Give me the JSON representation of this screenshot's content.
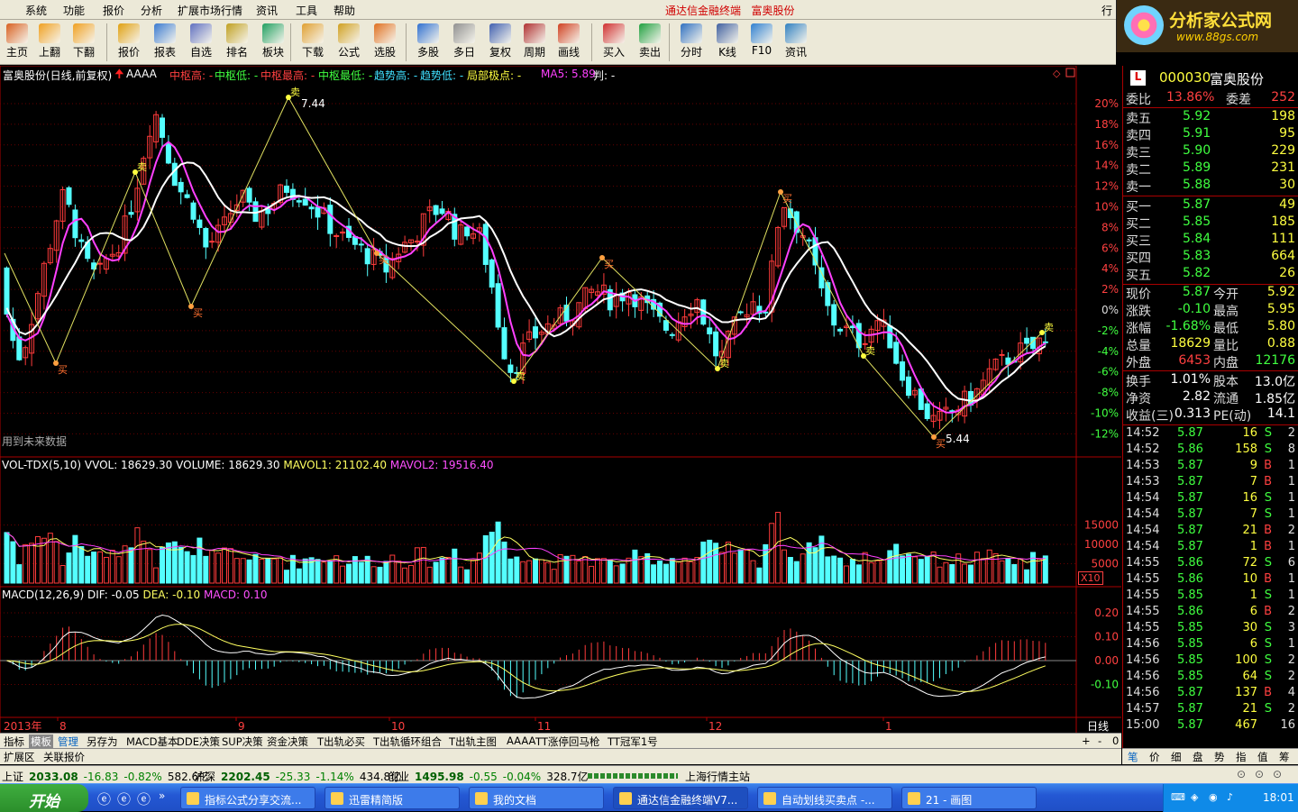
{
  "menu": {
    "items": [
      "系统",
      "功能",
      "报价",
      "分析",
      "扩展市场行情",
      "资讯",
      "工具",
      "帮助"
    ],
    "app_title": "通达信金融终端",
    "stock_name": "富奥股份",
    "right_partial": "行"
  },
  "logo": {
    "text": "分析家公式网",
    "url": "www.88gs.com"
  },
  "toolbar": {
    "buttons": [
      {
        "label": "主页",
        "icon": "home-icon",
        "color": "#d86020"
      },
      {
        "label": "上翻",
        "icon": "arrow-up-icon",
        "color": "#f0a020"
      },
      {
        "label": "下翻",
        "icon": "arrow-down-icon",
        "color": "#f0a020"
      },
      {
        "label": "报价",
        "icon": "yuan-icon",
        "color": "#e0a010"
      },
      {
        "label": "报表",
        "icon": "report-icon",
        "color": "#3a7ad0"
      },
      {
        "label": "自选",
        "icon": "f6-icon",
        "color": "#6070c0"
      },
      {
        "label": "排名",
        "icon": "rank-icon",
        "color": "#c0a020"
      },
      {
        "label": "板块",
        "icon": "sector-icon",
        "color": "#20a060"
      },
      {
        "label": "下载",
        "icon": "download-icon",
        "color": "#e0a030"
      },
      {
        "label": "公式",
        "icon": "formula-icon",
        "color": "#d0a020"
      },
      {
        "label": "选股",
        "icon": "stock-pick-icon",
        "color": "#e07020"
      },
      {
        "label": "多股",
        "icon": "multi-stock-icon",
        "color": "#3070d0"
      },
      {
        "label": "多日",
        "icon": "multi-day-icon",
        "color": "#909090"
      },
      {
        "label": "复权",
        "icon": "adjust-icon",
        "color": "#4060b0"
      },
      {
        "label": "周期",
        "icon": "f8-icon",
        "color": "#b03030"
      },
      {
        "label": "画线",
        "icon": "draw-line-icon",
        "color": "#d04020"
      },
      {
        "label": "买入",
        "icon": "buy-icon",
        "color": "#d03030"
      },
      {
        "label": "卖出",
        "icon": "sell-icon",
        "color": "#20a040"
      },
      {
        "label": "分时",
        "icon": "intraday-icon",
        "color": "#3070c0"
      },
      {
        "label": "K线",
        "icon": "kline-icon",
        "color": "#4060a0"
      },
      {
        "label": "F10",
        "icon": "f10-icon",
        "color": "#3080d0"
      },
      {
        "label": "资讯",
        "icon": "news-icon",
        "color": "#3080c0"
      }
    ]
  },
  "main_header": {
    "title": "富奥股份(日线,前复权)",
    "indicator": "AAAA",
    "items": [
      {
        "text": "中枢高: -",
        "color": "#ff4040"
      },
      {
        "text": "中枢低: -",
        "color": "#40ff40"
      },
      {
        "text": "中枢最高: -",
        "color": "#ff4040"
      },
      {
        "text": "中枢最低: -",
        "color": "#40ff40"
      },
      {
        "text": "趋势高: -",
        "color": "#40e0ff"
      },
      {
        "text": "趋势低: -",
        "color": "#40e0ff"
      },
      {
        "text": "局部极点: -",
        "color": "#ffff40"
      },
      {
        "text": "MA5: 5.89",
        "color": "#ff40ff"
      },
      {
        "text": "判: -",
        "color": "#ffffff"
      }
    ],
    "peak_high": "7.44",
    "trough_low": "5.44",
    "future_note": "用到未来数据",
    "sell_label": "卖",
    "buy_label": "买"
  },
  "vol_header": {
    "name": "VOL-TDX(5,10)",
    "vvol": "VVOL: 18629.30",
    "volume": "VOLUME: 18629.30",
    "mavol1": "MAVOL1: 21102.40",
    "mavol2": "MAVOL2: 19516.40",
    "unit": "X10"
  },
  "macd_header": {
    "name": "MACD(12,26,9)",
    "dif": "DIF: -0.05",
    "dea": "DEA: -0.10",
    "macd": "MACD: 0.10"
  },
  "axes": {
    "price_pct": [
      "20%",
      "18%",
      "16%",
      "14%",
      "12%",
      "10%",
      "8%",
      "6%",
      "4%",
      "2%",
      "0%",
      "-2%",
      "-4%",
      "-6%",
      "-8%",
      "-10%",
      "-12%"
    ],
    "vol": [
      "15000",
      "10000",
      "5000"
    ],
    "macd": [
      "0.20",
      "0.10",
      "0.00",
      "-0.10"
    ],
    "dates": [
      {
        "t": "2013年",
        "c": "#ff4040"
      },
      {
        "t": "8",
        "c": "#ff4040"
      },
      {
        "t": "9",
        "c": "#ff4040"
      },
      {
        "t": "10",
        "c": "#ff4040"
      },
      {
        "t": "11",
        "c": "#ff4040"
      },
      {
        "t": "12",
        "c": "#ff4040"
      },
      {
        "t": "1",
        "c": "#ff4040"
      }
    ],
    "period": "日线"
  },
  "tabs": {
    "row1": [
      "指标",
      "模板",
      "管理",
      "另存为",
      "MACD基本",
      "DDE决策",
      "SUP决策",
      "资金决策",
      "T出轨必买",
      "T出轨循环组合",
      "T出轨主图",
      "AAAA",
      "TT涨停回马枪",
      "TT冠军1号"
    ],
    "row1_ctrl": [
      "+",
      "-",
      "0"
    ],
    "row2": [
      "扩展区",
      "关联报价"
    ]
  },
  "quote": {
    "code": "000030",
    "name": "富奥股份",
    "badge": "L",
    "weibi": {
      "label": "委比",
      "val": "13.86%",
      "label2": "委差",
      "val2": "252"
    },
    "asks": [
      {
        "l": "卖五",
        "p": "5.92",
        "v": "198"
      },
      {
        "l": "卖四",
        "p": "5.91",
        "v": "95"
      },
      {
        "l": "卖三",
        "p": "5.90",
        "v": "229"
      },
      {
        "l": "卖二",
        "p": "5.89",
        "v": "231"
      },
      {
        "l": "卖一",
        "p": "5.88",
        "v": "30"
      }
    ],
    "bids": [
      {
        "l": "买一",
        "p": "5.87",
        "v": "49"
      },
      {
        "l": "买二",
        "p": "5.85",
        "v": "185"
      },
      {
        "l": "买三",
        "p": "5.84",
        "v": "111"
      },
      {
        "l": "买四",
        "p": "5.83",
        "v": "664"
      },
      {
        "l": "买五",
        "p": "5.82",
        "v": "26"
      }
    ],
    "stats": [
      {
        "l1": "现价",
        "v1": "5.87",
        "c1": "#40ff40",
        "l2": "今开",
        "v2": "5.92",
        "c2": "#ffff40"
      },
      {
        "l1": "涨跌",
        "v1": "-0.10",
        "c1": "#40ff40",
        "l2": "最高",
        "v2": "5.95",
        "c2": "#ffff40"
      },
      {
        "l1": "涨幅",
        "v1": "-1.68%",
        "c1": "#40ff40",
        "l2": "最低",
        "v2": "5.80",
        "c2": "#ffff40"
      },
      {
        "l1": "总量",
        "v1": "18629",
        "c1": "#ffff40",
        "l2": "量比",
        "v2": "0.88",
        "c2": "#ffff40"
      },
      {
        "l1": "外盘",
        "v1": "6453",
        "c1": "#ff4040",
        "l2": "内盘",
        "v2": "12176",
        "c2": "#40ff40"
      },
      {
        "l1": "换手",
        "v1": "1.01%",
        "c1": "#ffffff",
        "l2": "股本",
        "v2": "13.0亿",
        "c2": "#ffffff"
      },
      {
        "l1": "净资",
        "v1": "2.82",
        "c1": "#ffffff",
        "l2": "流通",
        "v2": "1.85亿",
        "c2": "#ffffff"
      },
      {
        "l1": "收益(三)",
        "v1": "0.313",
        "c1": "#ffffff",
        "l2": "PE(动)",
        "v2": "14.1",
        "c2": "#ffffff"
      }
    ],
    "ticks": [
      {
        "t": "14:52",
        "p": "5.87",
        "v": "16",
        "s": "S",
        "n": "2"
      },
      {
        "t": "14:52",
        "p": "5.86",
        "v": "158",
        "s": "S",
        "n": "8"
      },
      {
        "t": "14:53",
        "p": "5.87",
        "v": "9",
        "s": "B",
        "n": "1"
      },
      {
        "t": "14:53",
        "p": "5.87",
        "v": "7",
        "s": "B",
        "n": "1"
      },
      {
        "t": "14:54",
        "p": "5.87",
        "v": "16",
        "s": "S",
        "n": "1"
      },
      {
        "t": "14:54",
        "p": "5.87",
        "v": "7",
        "s": "S",
        "n": "1"
      },
      {
        "t": "14:54",
        "p": "5.87",
        "v": "21",
        "s": "B",
        "n": "2"
      },
      {
        "t": "14:54",
        "p": "5.87",
        "v": "1",
        "s": "B",
        "n": "1"
      },
      {
        "t": "14:55",
        "p": "5.86",
        "v": "72",
        "s": "S",
        "n": "6"
      },
      {
        "t": "14:55",
        "p": "5.86",
        "v": "10",
        "s": "B",
        "n": "1"
      },
      {
        "t": "14:55",
        "p": "5.85",
        "v": "1",
        "s": "S",
        "n": "1"
      },
      {
        "t": "14:55",
        "p": "5.86",
        "v": "6",
        "s": "B",
        "n": "2"
      },
      {
        "t": "14:55",
        "p": "5.85",
        "v": "30",
        "s": "S",
        "n": "3"
      },
      {
        "t": "14:56",
        "p": "5.85",
        "v": "6",
        "s": "S",
        "n": "1"
      },
      {
        "t": "14:56",
        "p": "5.85",
        "v": "100",
        "s": "S",
        "n": "2"
      },
      {
        "t": "14:56",
        "p": "5.85",
        "v": "64",
        "s": "S",
        "n": "2"
      },
      {
        "t": "14:56",
        "p": "5.87",
        "v": "137",
        "s": "B",
        "n": "4"
      },
      {
        "t": "14:57",
        "p": "5.87",
        "v": "21",
        "s": "S",
        "n": "2"
      },
      {
        "t": "15:00",
        "p": "5.87",
        "v": "467",
        "s": "",
        "n": "16"
      }
    ],
    "bottom_tabs": [
      "笔",
      "价",
      "细",
      "盘",
      "势",
      "指",
      "值",
      "筹"
    ]
  },
  "status": {
    "sh": {
      "l": "上证",
      "v": "2033.08",
      "c": "-16.83",
      "p": "-0.82%",
      "a": "582.6亿"
    },
    "sz": {
      "l": "沪深",
      "v": "2202.45",
      "c": "-25.33",
      "p": "-1.14%",
      "a": "434.8亿"
    },
    "cy": {
      "l": "创业",
      "v": "1495.98",
      "c": "-0.55",
      "p": "-0.04%",
      "a": "328.7亿"
    },
    "server": "上海行情主站"
  },
  "taskbar": {
    "start": "开始",
    "tasks": [
      "指标公式分享交流...",
      "迅雷精简版",
      "我的文档",
      "通达信金融终端V7...",
      "自动划线买卖点 -...",
      "21 - 画图"
    ],
    "clock": "18:01"
  },
  "chart_data": {
    "type": "candlestick",
    "title": "富奥股份(日线,前复权)",
    "series": [
      {
        "name": "MA5",
        "values": "derived"
      }
    ],
    "price_range_pct": [
      -13,
      21
    ],
    "annotations": [
      {
        "text": "7.44",
        "type": "peak"
      },
      {
        "text": "5.44",
        "type": "trough"
      }
    ],
    "volume_ylim": [
      0,
      18000
    ],
    "macd_ylim": [
      -0.2,
      0.25
    ]
  }
}
